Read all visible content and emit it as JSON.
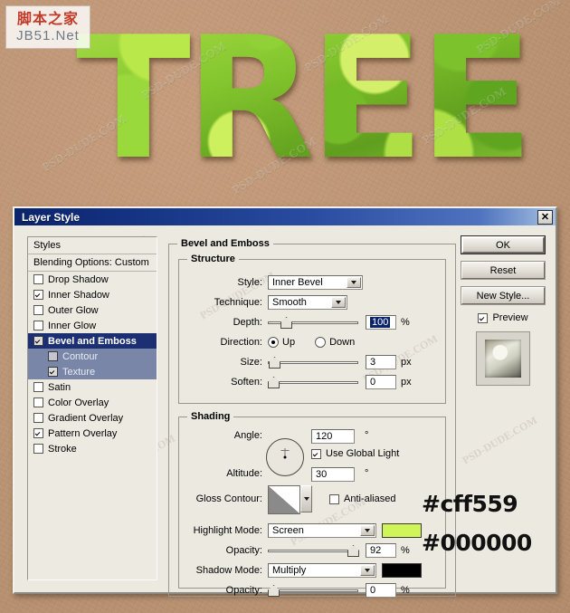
{
  "artwork": {
    "word": "TREE",
    "logo": {
      "cn": "脚本之家",
      "en": "JB51.Net"
    },
    "watermarks": [
      "PSD-DUDE.COM",
      "PSD-DUDE.COM",
      "PSD-DUDE.COM",
      "PSD-DUDE.COM",
      "PSD-DUDE.COM",
      "PSD-DUDE.COM"
    ]
  },
  "dialog": {
    "title": "Layer Style",
    "close_icon": "close-icon"
  },
  "styles_panel": {
    "header": "Styles",
    "blending": "Blending Options: Custom",
    "items": [
      {
        "label": "Drop Shadow",
        "checked": false,
        "selected": false,
        "sub": false
      },
      {
        "label": "Inner Shadow",
        "checked": true,
        "selected": false,
        "sub": false
      },
      {
        "label": "Outer Glow",
        "checked": false,
        "selected": false,
        "sub": false
      },
      {
        "label": "Inner Glow",
        "checked": false,
        "selected": false,
        "sub": false
      },
      {
        "label": "Bevel and Emboss",
        "checked": true,
        "selected": true,
        "sub": false
      },
      {
        "label": "Contour",
        "checked": false,
        "selected": false,
        "sub": true
      },
      {
        "label": "Texture",
        "checked": true,
        "selected": false,
        "sub": true
      },
      {
        "label": "Satin",
        "checked": false,
        "selected": false,
        "sub": false
      },
      {
        "label": "Color Overlay",
        "checked": false,
        "selected": false,
        "sub": false
      },
      {
        "label": "Gradient Overlay",
        "checked": false,
        "selected": false,
        "sub": false
      },
      {
        "label": "Pattern Overlay",
        "checked": true,
        "selected": false,
        "sub": false
      },
      {
        "label": "Stroke",
        "checked": false,
        "selected": false,
        "sub": false
      }
    ]
  },
  "bevel": {
    "group_title": "Bevel and Emboss",
    "structure": {
      "title": "Structure",
      "style_label": "Style:",
      "style_value": "Inner Bevel",
      "technique_label": "Technique:",
      "technique_value": "Smooth",
      "depth_label": "Depth:",
      "depth_value": "100",
      "depth_unit": "%",
      "depth_pct": 14,
      "direction_label": "Direction:",
      "direction_up": "Up",
      "direction_down": "Down",
      "direction_selected": "Up",
      "size_label": "Size:",
      "size_value": "3",
      "size_unit": "px",
      "size_pct": 2,
      "soften_label": "Soften:",
      "soften_value": "0",
      "soften_unit": "px",
      "soften_pct": 0
    },
    "shading": {
      "title": "Shading",
      "angle_label": "Angle:",
      "angle_value": "120",
      "angle_unit": "°",
      "use_global_light": "Use Global Light",
      "use_global_light_checked": true,
      "altitude_label": "Altitude:",
      "altitude_value": "30",
      "altitude_unit": "°",
      "gloss_contour_label": "Gloss Contour:",
      "anti_aliased": "Anti-aliased",
      "anti_aliased_checked": false,
      "highlight_mode_label": "Highlight Mode:",
      "highlight_mode_value": "Screen",
      "highlight_color": "#cff559",
      "highlight_opacity_label": "Opacity:",
      "highlight_opacity_value": "92",
      "highlight_opacity_unit": "%",
      "highlight_opacity_pct": 92,
      "shadow_mode_label": "Shadow Mode:",
      "shadow_mode_value": "Multiply",
      "shadow_color": "#000000",
      "shadow_opacity_label": "Opacity:",
      "shadow_opacity_value": "0",
      "shadow_opacity_unit": "%",
      "shadow_opacity_pct": 0
    }
  },
  "buttons": {
    "ok": "OK",
    "reset": "Reset",
    "new_style": "New Style...",
    "preview_label": "Preview",
    "preview_checked": true
  },
  "annotations": {
    "highlight_hex": "#cff559",
    "shadow_hex": "#000000"
  }
}
